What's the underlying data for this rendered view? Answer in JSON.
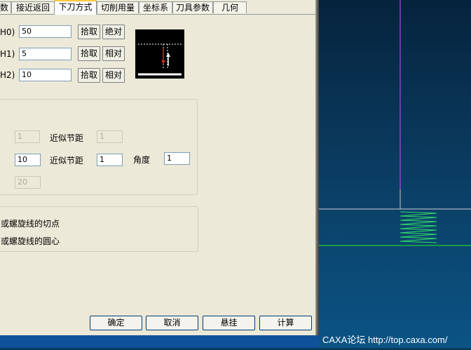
{
  "tabs": [
    "数",
    "接近返回",
    "下刀方式",
    "切削用量",
    "坐标系",
    "刀具参数",
    "几何"
  ],
  "active_tab": "下刀方式",
  "heights": [
    {
      "label": "H0)",
      "value": "50",
      "pick": "拾取",
      "mode": "绝对"
    },
    {
      "label": "H1)",
      "value": "5",
      "pick": "拾取",
      "mode": "相对"
    },
    {
      "label": "H2)",
      "value": "10",
      "pick": "拾取",
      "mode": "相对"
    }
  ],
  "group1": {
    "row1": {
      "value": "1",
      "label": "近似节距",
      "value2": "1"
    },
    "row2": {
      "value": "10",
      "label": "近似节距",
      "value2": "1",
      "angle_label": "角度",
      "angle_value": "1"
    },
    "row3": {
      "value": "20"
    }
  },
  "group2": {
    "line1": "或螺旋线的切点",
    "line2": "或螺旋线的圆心"
  },
  "buttons": {
    "ok": "确定",
    "cancel": "取消",
    "hang": "悬挂",
    "calc": "计算"
  },
  "credit": "CAXA论坛 http://top.caxa.com/",
  "colors": {
    "dialog_bg": "#ece9d8",
    "viewport_bg": "#0b3f66",
    "toolpath": "#33dd66",
    "axis": "#aa44ee"
  }
}
